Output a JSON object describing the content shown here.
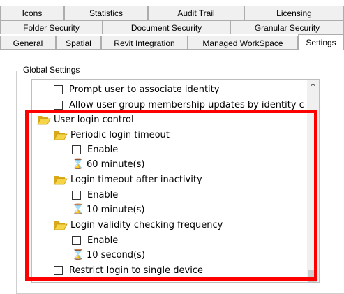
{
  "tabs": {
    "row1": [
      "Icons",
      "Statistics",
      "Audit Trail",
      "Licensing"
    ],
    "row2": [
      "Folder Security",
      "Document Security",
      "Granular Security"
    ],
    "row3": [
      "General",
      "Spatial",
      "Revit Integration",
      "Managed WorkSpace",
      "Settings"
    ],
    "active": "Settings"
  },
  "group": {
    "title": "Global Settings"
  },
  "tree": {
    "items": {
      "prompt_identity": "Prompt user to associate identity",
      "allow_group_updates": "Allow user group membership updates by identity c",
      "user_login_control": "User login control",
      "periodic_timeout": "Periodic login timeout",
      "periodic_enable": "Enable",
      "periodic_value": "60 minute(s)",
      "inactivity_timeout": "Login timeout after inactivity",
      "inactivity_enable": "Enable",
      "inactivity_value": "10 minute(s)",
      "validity_frequency": "Login validity checking frequency",
      "validity_enable": "Enable",
      "validity_value": "10 second(s)",
      "restrict_single_device": "Restrict login to single device"
    },
    "icons": {
      "folder": "folder-open-icon",
      "timer": "hourglass-icon",
      "scroll": "scroll-up-arrow-icon"
    }
  },
  "colors": {
    "highlight": "#ff0000",
    "folder": "#e8c430"
  }
}
